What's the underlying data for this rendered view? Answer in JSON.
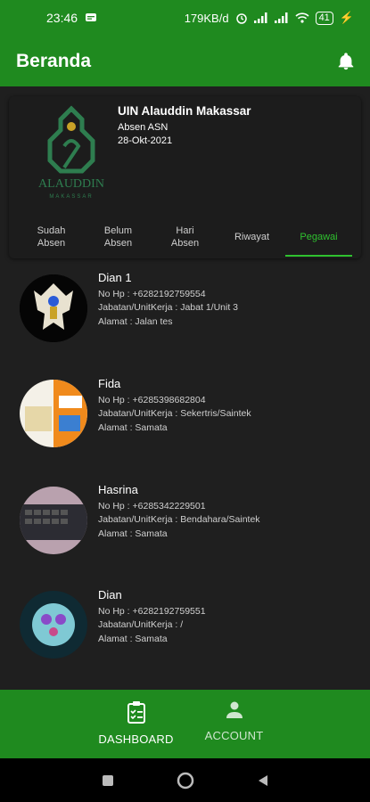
{
  "statusbar": {
    "time": "23:46",
    "net_speed": "179KB/d",
    "battery": "41"
  },
  "appbar": {
    "title": "Beranda"
  },
  "header_card": {
    "logo_text": "ALAUDDIN",
    "logo_subtext": "MAKASSAR",
    "institution": "UIN Alauddin Makassar",
    "subtitle": "Absen ASN",
    "date": "28-Okt-2021"
  },
  "tabs": [
    {
      "label": "Sudah\nAbsen"
    },
    {
      "label": "Belum\nAbsen"
    },
    {
      "label": "Hari\nAbsen"
    },
    {
      "label": "Riwayat"
    },
    {
      "label": "Pegawai"
    }
  ],
  "employees": [
    {
      "name": "Dian 1",
      "phone": "No Hp : +6282192759554",
      "job": "Jabatan/UnitKerja : Jabat 1/Unit 3",
      "address": "Alamat : Jalan tes"
    },
    {
      "name": "Fida",
      "phone": "No Hp : +6285398682804",
      "job": "Jabatan/UnitKerja : Sekertris/Saintek",
      "address": "Alamat : Samata"
    },
    {
      "name": "Hasrina",
      "phone": "No Hp : +6285342229501",
      "job": "Jabatan/UnitKerja : Bendahara/Saintek",
      "address": "Alamat : Samata"
    },
    {
      "name": "Dian",
      "phone": "No Hp : +6282192759551",
      "job": "Jabatan/UnitKerja : /",
      "address": "Alamat : Samata"
    }
  ],
  "bottom_nav": {
    "dashboard": "DASHBOARD",
    "account": "ACCOUNT"
  },
  "colors": {
    "primary": "#1f8a1f",
    "accent": "#2fc12f",
    "background": "#1f1f1f"
  },
  "icons": [
    "bell-icon",
    "clipboard-icon",
    "person-icon",
    "wifi-icon",
    "signal-icon",
    "alarm-icon"
  ]
}
